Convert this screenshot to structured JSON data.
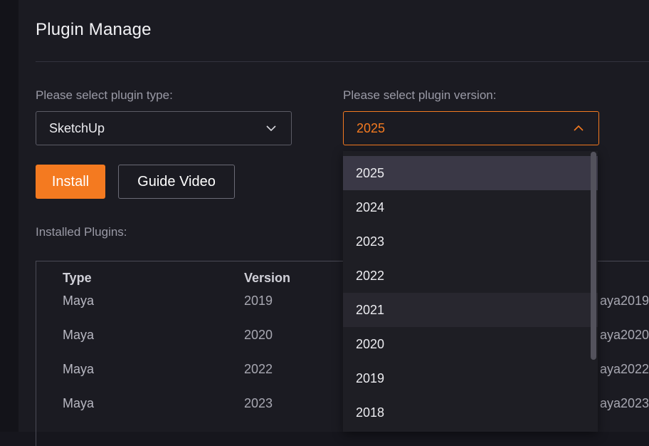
{
  "page": {
    "title": "Plugin Manage"
  },
  "type_select": {
    "label": "Please select plugin type:",
    "value": "SketchUp"
  },
  "version_select": {
    "label": "Please select plugin version:",
    "value": "2025"
  },
  "buttons": {
    "install": "Install",
    "guide_video": "Guide Video"
  },
  "installed": {
    "label": "Installed Plugins:",
    "columns": [
      "Type",
      "Version"
    ],
    "rows": [
      {
        "type": "Maya",
        "version": "2019",
        "extra": "aya2019"
      },
      {
        "type": "Maya",
        "version": "2020",
        "extra": "aya2020"
      },
      {
        "type": "Maya",
        "version": "2022",
        "extra": "aya2022"
      },
      {
        "type": "Maya",
        "version": "2023",
        "extra": "aya2023"
      }
    ]
  },
  "version_options": [
    "2025",
    "2024",
    "2023",
    "2022",
    "2021",
    "2020",
    "2019",
    "2018"
  ],
  "colors": {
    "accent": "#f47a20",
    "background": "#1b1b22",
    "selected_option": "#3a3846"
  }
}
